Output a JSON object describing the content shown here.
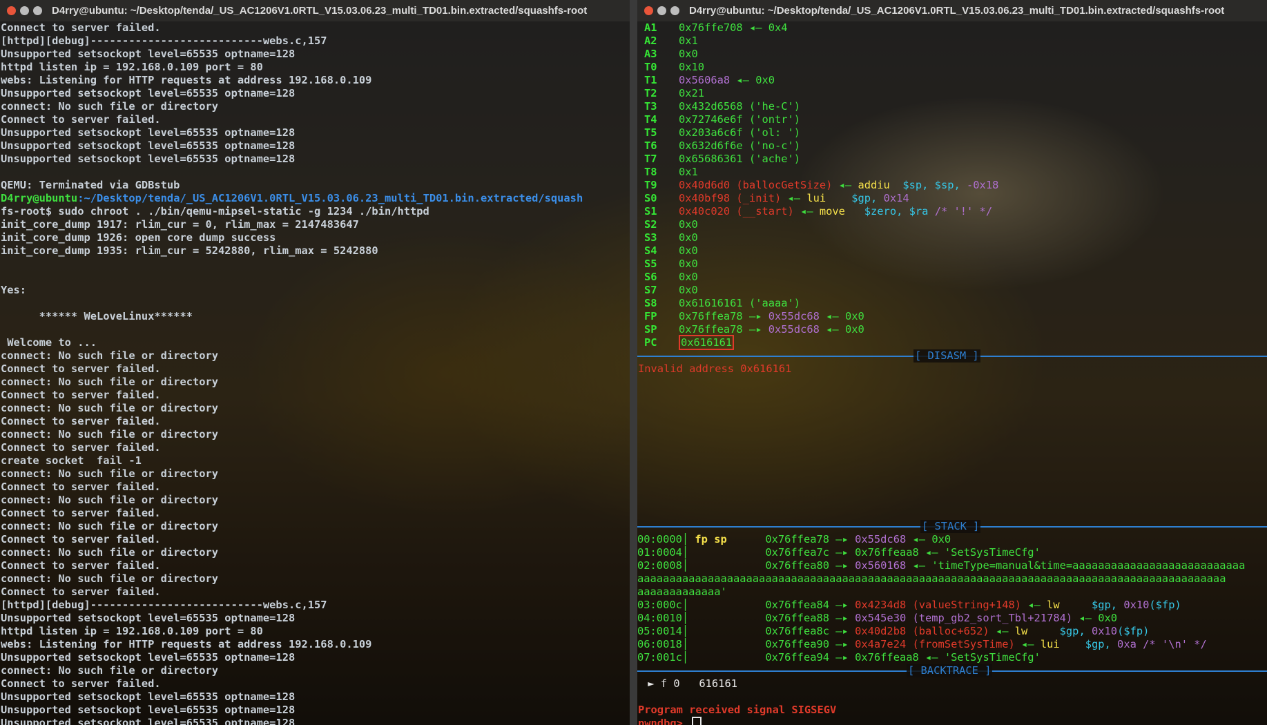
{
  "left": {
    "title": "D4rry@ubuntu: ~/Desktop/tenda/_US_AC1206V1.0RTL_V15.03.06.23_multi_TD01.bin.extracted/squashfs-root",
    "lines": [
      "Connect to server failed.",
      "[httpd][debug]---------------------------webs.c,157",
      "Unsupported setsockopt level=65535 optname=128",
      "httpd listen ip = 192.168.0.109 port = 80",
      "webs: Listening for HTTP requests at address 192.168.0.109",
      "Unsupported setsockopt level=65535 optname=128",
      "connect: No such file or directory",
      "Connect to server failed.",
      "Unsupported setsockopt level=65535 optname=128",
      "Unsupported setsockopt level=65535 optname=128",
      "Unsupported setsockopt level=65535 optname=128",
      "",
      "QEMU: Terminated via GDBstub",
      "D4rry@ubuntu:~/Desktop/tenda/_US_AC1206V1.0RTL_V15.03.06.23_multi_TD01.bin.extracted/squash",
      "fs-root$ sudo chroot . ./bin/qemu-mipsel-static -g 1234 ./bin/httpd",
      "init_core_dump 1917: rlim_cur = 0, rlim_max = 2147483647",
      "init_core_dump 1926: open core dump success",
      "init_core_dump 1935: rlim_cur = 5242880, rlim_max = 5242880",
      "",
      "",
      "Yes:",
      "",
      "      ****** WeLoveLinux******",
      "",
      " Welcome to ...",
      "connect: No such file or directory",
      "Connect to server failed.",
      "connect: No such file or directory",
      "Connect to server failed.",
      "connect: No such file or directory",
      "Connect to server failed.",
      "connect: No such file or directory",
      "Connect to server failed.",
      "create socket  fail -1",
      "connect: No such file or directory",
      "Connect to server failed.",
      "connect: No such file or directory",
      "Connect to server failed.",
      "connect: No such file or directory",
      "Connect to server failed.",
      "connect: No such file or directory",
      "Connect to server failed.",
      "connect: No such file or directory",
      "Connect to server failed.",
      "[httpd][debug]---------------------------webs.c,157",
      "Unsupported setsockopt level=65535 optname=128",
      "httpd listen ip = 192.168.0.109 port = 80",
      "webs: Listening for HTTP requests at address 192.168.0.109",
      "Unsupported setsockopt level=65535 optname=128",
      "connect: No such file or directory",
      "Connect to server failed.",
      "Unsupported setsockopt level=65535 optname=128",
      "Unsupported setsockopt level=65535 optname=128",
      "Unsupported setsockopt level=65535 optname=128"
    ]
  },
  "right": {
    "title": "D4rry@ubuntu: ~/Desktop/tenda/_US_AC1206V1.0RTL_V15.03.06.23_multi_TD01.bin.extracted/squashfs-root",
    "registers": [
      {
        "name": "A1",
        "segs": [
          [
            "green",
            "0x76ffe708"
          ],
          [
            "green",
            " ◂— "
          ],
          [
            "green",
            "0x4"
          ]
        ]
      },
      {
        "name": "A2",
        "segs": [
          [
            "green",
            "0x1"
          ]
        ]
      },
      {
        "name": "A3",
        "segs": [
          [
            "green",
            "0x0"
          ]
        ]
      },
      {
        "name": "T0",
        "segs": [
          [
            "green",
            "0x10"
          ]
        ]
      },
      {
        "name": "T1",
        "segs": [
          [
            "purple",
            "0x5606a8"
          ],
          [
            "green",
            " ◂— "
          ],
          [
            "green",
            "0x0"
          ]
        ]
      },
      {
        "name": "T2",
        "segs": [
          [
            "green",
            "0x21"
          ]
        ]
      },
      {
        "name": "T3",
        "segs": [
          [
            "green",
            "0x432d6568 ('he-C')"
          ]
        ]
      },
      {
        "name": "T4",
        "segs": [
          [
            "green",
            "0x72746e6f ('ontr')"
          ]
        ]
      },
      {
        "name": "T5",
        "segs": [
          [
            "green",
            "0x203a6c6f ('ol: ')"
          ]
        ]
      },
      {
        "name": "T6",
        "segs": [
          [
            "green",
            "0x632d6f6e ('no-c')"
          ]
        ]
      },
      {
        "name": "T7",
        "segs": [
          [
            "green",
            "0x65686361 ('ache')"
          ]
        ]
      },
      {
        "name": "T8",
        "segs": [
          [
            "green",
            "0x1"
          ]
        ]
      },
      {
        "name": "T9",
        "segs": [
          [
            "red",
            "0x40d6d0 (ballocGetSize)"
          ],
          [
            "green",
            " ◂— "
          ],
          [
            "yellow",
            "addiu  "
          ],
          [
            "cyan",
            "$sp, $sp, "
          ],
          [
            "purple",
            "-0x18"
          ]
        ]
      },
      {
        "name": "S0",
        "segs": [
          [
            "red",
            "0x40bf98 (_init)"
          ],
          [
            "green",
            " ◂— "
          ],
          [
            "yellow",
            "lui    "
          ],
          [
            "cyan",
            "$gp, "
          ],
          [
            "purple",
            "0x14"
          ]
        ]
      },
      {
        "name": "S1",
        "segs": [
          [
            "red",
            "0x40c020 (__start)"
          ],
          [
            "green",
            " ◂— "
          ],
          [
            "yellow",
            "move   "
          ],
          [
            "cyan",
            "$zero, $ra "
          ],
          [
            "purple",
            "/* '!' */"
          ]
        ]
      },
      {
        "name": "S2",
        "segs": [
          [
            "green",
            "0x0"
          ]
        ]
      },
      {
        "name": "S3",
        "segs": [
          [
            "green",
            "0x0"
          ]
        ]
      },
      {
        "name": "S4",
        "segs": [
          [
            "green",
            "0x0"
          ]
        ]
      },
      {
        "name": "S5",
        "segs": [
          [
            "green",
            "0x0"
          ]
        ]
      },
      {
        "name": "S6",
        "segs": [
          [
            "green",
            "0x0"
          ]
        ]
      },
      {
        "name": "S7",
        "segs": [
          [
            "green",
            "0x0"
          ]
        ]
      },
      {
        "name": "S8",
        "segs": [
          [
            "green",
            "0x61616161 ('aaaa')"
          ]
        ]
      },
      {
        "name": "FP",
        "segs": [
          [
            "green",
            "0x76ffea78"
          ],
          [
            "green",
            " —▸ "
          ],
          [
            "purple",
            "0x55dc68"
          ],
          [
            "green",
            " ◂— "
          ],
          [
            "green",
            "0x0"
          ]
        ]
      },
      {
        "name": "SP",
        "segs": [
          [
            "green",
            "0x76ffea78"
          ],
          [
            "green",
            " —▸ "
          ],
          [
            "purple",
            "0x55dc68"
          ],
          [
            "green",
            " ◂— "
          ],
          [
            "green",
            "0x0"
          ]
        ]
      }
    ],
    "pc_name": "PC",
    "pc_value": "0x616161",
    "disasm_label": "[ DISASM ]",
    "disasm_error": "Invalid address 0x616161",
    "stack_label": "[ STACK ]",
    "stack": [
      {
        "off": "00:0000",
        "tag": " fp sp ",
        "segs": [
          [
            "green",
            "0x76ffea78"
          ],
          [
            "green",
            " —▸ "
          ],
          [
            "purple",
            "0x55dc68"
          ],
          [
            "green",
            " ◂— "
          ],
          [
            "green",
            "0x0"
          ]
        ]
      },
      {
        "off": "01:0004",
        "tag": "       ",
        "segs": [
          [
            "green",
            "0x76ffea7c"
          ],
          [
            "green",
            " —▸ "
          ],
          [
            "green",
            "0x76ffeaa8"
          ],
          [
            "green",
            " ◂— "
          ],
          [
            "green",
            "'SetSysTimeCfg'"
          ]
        ]
      },
      {
        "off": "02:0008",
        "tag": "       ",
        "segs": [
          [
            "green",
            "0x76ffea80"
          ],
          [
            "green",
            " —▸ "
          ],
          [
            "purple",
            "0x560168"
          ],
          [
            "green",
            " ◂— "
          ],
          [
            "green",
            "'timeType=manual&time=aaaaaaaaaaaaaaaaaaaaaaaaaaa"
          ]
        ]
      },
      {
        "off": "",
        "tag": "",
        "segs": [
          [
            "green",
            "aaaaaaaaaaaaaaaaaaaaaaaaaaaaaaaaaaaaaaaaaaaaaaaaaaaaaaaaaaaaaaaaaaaaaaaaaaaaaaaaaaaaaaaaaaaa"
          ]
        ]
      },
      {
        "off": "",
        "tag": "",
        "segs": [
          [
            "green",
            "aaaaaaaaaaaaa'"
          ]
        ]
      },
      {
        "off": "03:000c",
        "tag": "       ",
        "segs": [
          [
            "green",
            "0x76ffea84"
          ],
          [
            "green",
            " —▸ "
          ],
          [
            "red",
            "0x4234d8 (valueString+148)"
          ],
          [
            "green",
            " ◂— "
          ],
          [
            "yellow",
            "lw     "
          ],
          [
            "cyan",
            "$gp, "
          ],
          [
            "purple",
            "0x10"
          ],
          [
            "cyan",
            "($fp)"
          ]
        ]
      },
      {
        "off": "04:0010",
        "tag": "       ",
        "segs": [
          [
            "green",
            "0x76ffea88"
          ],
          [
            "green",
            " —▸ "
          ],
          [
            "purple",
            "0x545e30 (temp_gb2_sort_Tbl+21784)"
          ],
          [
            "green",
            " ◂— "
          ],
          [
            "green",
            "0x0"
          ]
        ]
      },
      {
        "off": "05:0014",
        "tag": "       ",
        "segs": [
          [
            "green",
            "0x76ffea8c"
          ],
          [
            "green",
            " —▸ "
          ],
          [
            "red",
            "0x40d2b8 (balloc+652)"
          ],
          [
            "green",
            " ◂— "
          ],
          [
            "yellow",
            "lw     "
          ],
          [
            "cyan",
            "$gp, "
          ],
          [
            "purple",
            "0x10"
          ],
          [
            "cyan",
            "($fp)"
          ]
        ]
      },
      {
        "off": "06:0018",
        "tag": "       ",
        "segs": [
          [
            "green",
            "0x76ffea90"
          ],
          [
            "green",
            " —▸ "
          ],
          [
            "red",
            "0x4a7e24 (fromSetSysTime)"
          ],
          [
            "green",
            " ◂— "
          ],
          [
            "yellow",
            "lui    "
          ],
          [
            "cyan",
            "$gp, "
          ],
          [
            "purple",
            "0xa "
          ],
          [
            "purple",
            "/* '\\n' */"
          ]
        ]
      },
      {
        "off": "07:001c",
        "tag": "       ",
        "segs": [
          [
            "green",
            "0x76ffea94"
          ],
          [
            "green",
            " —▸ "
          ],
          [
            "green",
            "0x76ffeaa8"
          ],
          [
            "green",
            " ◂— "
          ],
          [
            "green",
            "'SetSysTimeCfg'"
          ]
        ]
      }
    ],
    "backtrace_label": "[ BACKTRACE ]",
    "backtrace": " ► f 0   616161",
    "signal": "Program received signal SIGSEGV",
    "prompt": "pwndbg> "
  },
  "colors": {
    "close": "#e9553a",
    "minimize": "#bdbdbd",
    "maximize": "#bdbdbd",
    "accent_green": "#3fe03f",
    "accent_red": "#e03a2a",
    "separator_blue": "#2e7fd0"
  }
}
